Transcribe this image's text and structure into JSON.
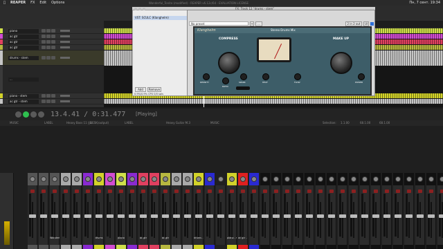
{
  "menubar": {
    "app": "REAPER",
    "items": [
      "FX",
      "Edit",
      "Options"
    ],
    "clock": "Пн, 7 сент. 19:34"
  },
  "title": {
    "project": "Wonderful_Tonite (modified) - REAPER v6.12c/64 - EVALUATION LICENSE",
    "fx_chain": "FX: Track 12 \"drums - stem\""
  },
  "tracks": [
    {
      "name": "piano",
      "color": "#cfe04a"
    },
    {
      "name": "ac gtr",
      "color": "#d24cd2"
    },
    {
      "name": "ac gtr",
      "color": "#e04060"
    },
    {
      "name": "ac gtr",
      "color": "#b8b840"
    },
    {
      "name": "drums - stem",
      "color": "#c6c6c6"
    },
    {
      "name": "...",
      "color": "#3a3a3a"
    },
    {
      "name": "piano - stem",
      "color": "#d2d22a"
    },
    {
      "name": "ac gtr - stem",
      "color": "#c6c6c6"
    }
  ],
  "transport": {
    "time": "13.4.41 / 0:31.477",
    "status": "[Playing]"
  },
  "ruler": [
    "MUSIC",
    "LABEL",
    "Heavy Bass 11 (Ja...",
    "DESK(output)",
    "LABEL",
    "Heavy Guitar M.3",
    "MUSIC",
    "Selection:",
    "1.1.00",
    "68.1.00",
    "68.1.00"
  ],
  "fx_window": {
    "plugin_item": "VST: SCULC (Klanghelm)",
    "preset": "No preset",
    "cpu": "0.9%/0.9% CPU 0/0 spls",
    "add": "Add",
    "remove": "Remove",
    "brand": "Klanghelm",
    "preset_name": "Stereo Drums Mix",
    "sections": [
      "COMPRESS",
      "MAKE UP"
    ],
    "knobs": [
      "DENSITY",
      "RATIO",
      "SPARK",
      "HEAT",
      "VALUE",
      "FLOW",
      "TURN",
      "POWER"
    ],
    "io": "2 in 2 out",
    "ui_label": "UI"
  },
  "mixer": {
    "strips": [
      {
        "name": "",
        "hdr": "#555555"
      },
      {
        "name": "",
        "hdr": "#555555"
      },
      {
        "name": "Wonderful_Tonig",
        "hdr": "#555555"
      },
      {
        "name": "",
        "hdr": "#aaaaaa"
      },
      {
        "name": "",
        "hdr": "#aaaaaa"
      },
      {
        "name": "",
        "hdr": "#8a2ad2"
      },
      {
        "name": "drums",
        "hdr": "#d2d22a"
      },
      {
        "name": "",
        "hdr": "#d24cd2"
      },
      {
        "name": "piano",
        "hdr": "#cfe04a"
      },
      {
        "name": "",
        "hdr": "#8a2ad2"
      },
      {
        "name": "ac gtr",
        "hdr": "#e04060"
      },
      {
        "name": "",
        "hdr": "#e04060"
      },
      {
        "name": "ac gtr",
        "hdr": "#b8b840"
      },
      {
        "name": "",
        "hdr": "#aaaaaa"
      },
      {
        "name": "",
        "hdr": "#aaaaaa"
      },
      {
        "name": "drums - stem",
        "hdr": "#d2d22a"
      },
      {
        "name": "",
        "hdr": "#2a2ad2"
      },
      {
        "name": "",
        "hdr": "#202020"
      },
      {
        "name": "piano - stem",
        "hdr": "#d2d22a"
      },
      {
        "name": "ac gtr - stem",
        "hdr": "#e02020"
      },
      {
        "name": "",
        "hdr": "#2a2ad2"
      },
      {
        "name": "",
        "hdr": "#111111"
      },
      {
        "name": "",
        "hdr": "#111111"
      },
      {
        "name": "",
        "hdr": "#111111"
      },
      {
        "name": "",
        "hdr": "#111111"
      },
      {
        "name": "",
        "hdr": "#111111"
      },
      {
        "name": "",
        "hdr": "#111111"
      },
      {
        "name": "",
        "hdr": "#111111"
      },
      {
        "name": "",
        "hdr": "#111111"
      },
      {
        "name": "",
        "hdr": "#111111"
      },
      {
        "name": "",
        "hdr": "#111111"
      },
      {
        "name": "",
        "hdr": "#111111"
      },
      {
        "name": "",
        "hdr": "#111111"
      },
      {
        "name": "",
        "hdr": "#111111"
      },
      {
        "name": "",
        "hdr": "#111111"
      },
      {
        "name": "",
        "hdr": "#111111"
      },
      {
        "name": "",
        "hdr": "#111111"
      },
      {
        "name": "",
        "hdr": "#111111"
      }
    ]
  }
}
